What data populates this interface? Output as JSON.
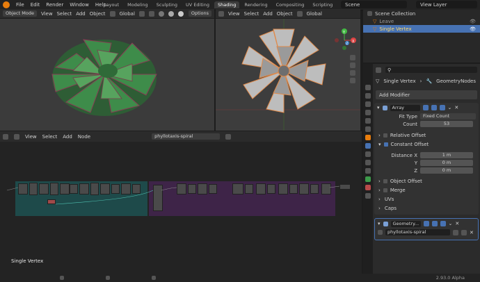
{
  "topbar": {
    "menus": [
      "File",
      "Edit",
      "Render",
      "Window",
      "Help"
    ],
    "tabs": [
      "Layout",
      "Modeling",
      "Sculpting",
      "UV Editing",
      "Shading",
      "Rendering",
      "Compositing",
      "Scripting"
    ],
    "active_tab": "Shading",
    "scene": "Scene",
    "view_layer": "View Layer"
  },
  "viewport_left": {
    "mode": "Object Mode",
    "menus": [
      "View",
      "Select",
      "Add",
      "Object"
    ],
    "transform": "Global",
    "options": "Options"
  },
  "viewport_right": {
    "menus": [
      "View",
      "Select",
      "Add",
      "Object"
    ],
    "transform": "Global",
    "gizmo": {
      "x": "X",
      "y": "Y",
      "z": "Z"
    }
  },
  "node_editor": {
    "menus": [
      "View",
      "Select",
      "Add",
      "Node"
    ],
    "tree_name": "phyllotaxis-spiral",
    "overlay_label": "Single Vertex"
  },
  "outliner": {
    "title": "Scene Collection",
    "items": [
      {
        "label": "Leave",
        "selected": false
      },
      {
        "label": "Single Vertex",
        "selected": true
      }
    ]
  },
  "properties": {
    "object": "Single Vertex",
    "modifier_tab": "GeometryNodes",
    "add_modifier": "Add Modifier",
    "array": {
      "name": "Array",
      "fit_type_label": "Fit Type",
      "fit_type": "Fixed Count",
      "count_label": "Count",
      "count": "53",
      "relative_offset": "Relative Offset",
      "constant_offset": "Constant Offset",
      "distance_x_label": "Distance X",
      "distance_x": "1 m",
      "y_label": "Y",
      "y": "0 m",
      "z_label": "Z",
      "z": "0 m",
      "object_offset": "Object Offset",
      "merge": "Merge",
      "uvs": "UVs",
      "caps": "Caps"
    },
    "geometry": {
      "name": "Geometry...",
      "tree": "phyllotaxis-spiral"
    }
  },
  "status": {
    "version": "2.93.0 Alpha"
  },
  "colors": {
    "accent": "#4772b3",
    "orange": "#e87d0d",
    "frame_teal": "#1e4a4a",
    "frame_purple": "#3e2448"
  }
}
